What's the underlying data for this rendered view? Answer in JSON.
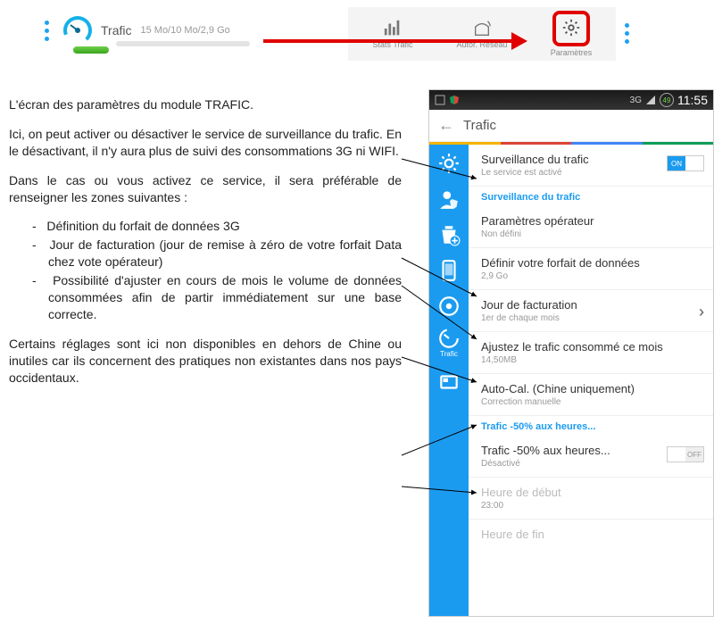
{
  "topbar": {
    "trafic_label": "Trafic",
    "trafic_stats": "15 Mo/10 Mo/2,9 Go",
    "tabs": [
      {
        "label": "Stats Trafic",
        "icon": "bars-icon"
      },
      {
        "label": "Autor. Réseau",
        "icon": "wifi-icon"
      },
      {
        "label": "Paramètres",
        "icon": "gear-icon"
      }
    ]
  },
  "text": {
    "p1": "L'écran des paramètres du module TRAFIC.",
    "p2": "Ici, on peut activer ou désactiver le service de surveillance du trafic. En le désactivant, il n'y aura plus de suivi des consommations 3G ni WIFI.",
    "p3": "Dans le cas ou vous activez ce service, il sera préférable de renseigner les zones suivantes :",
    "li1": "Définition du forfait de données 3G",
    "li2": "Jour de facturation (jour de remise à zéro de votre forfait Data chez vote opérateur)",
    "li3": "Possibilité d'ajuster en cours de mois le volume de données consommées afin de partir immédiatement sur une base correcte.",
    "p4": "Certains réglages sont ici non disponibles en dehors de Chine ou inutiles car ils concernent des pratiques non existantes dans nos pays occidentaux."
  },
  "phone": {
    "status": {
      "net": "3G",
      "battery": "49",
      "time": "11:55"
    },
    "header": "Trafic",
    "googlecolors": [
      "#f4b400",
      "#db4437",
      "#4285f4",
      "#0f9d58"
    ],
    "sidebar_label": "Trafic",
    "rows": {
      "r1": {
        "title": "Surveillance du trafic",
        "sub": "Le service est activé",
        "toggle": "ON"
      },
      "section1": "Surveillance du trafic",
      "r2": {
        "title": "Paramètres opérateur",
        "sub": "Non défini"
      },
      "r3": {
        "title": "Définir votre forfait de données",
        "sub": "2,9 Go"
      },
      "r4": {
        "title": "Jour de facturation",
        "sub": "1er de chaque mois"
      },
      "r5": {
        "title": "Ajustez le trafic consommé ce mois",
        "sub": "14,50MB"
      },
      "r6": {
        "title": "Auto-Cal. (Chine uniquement)",
        "sub": "Correction manuelle"
      },
      "section2": "Trafic -50% aux heures...",
      "r7": {
        "title": "Trafic -50% aux heures...",
        "sub": "Désactivé",
        "toggle": "OFF"
      },
      "r8": {
        "title": "Heure de début",
        "sub": "23:00"
      },
      "r9": {
        "title": "Heure de fin"
      }
    }
  }
}
